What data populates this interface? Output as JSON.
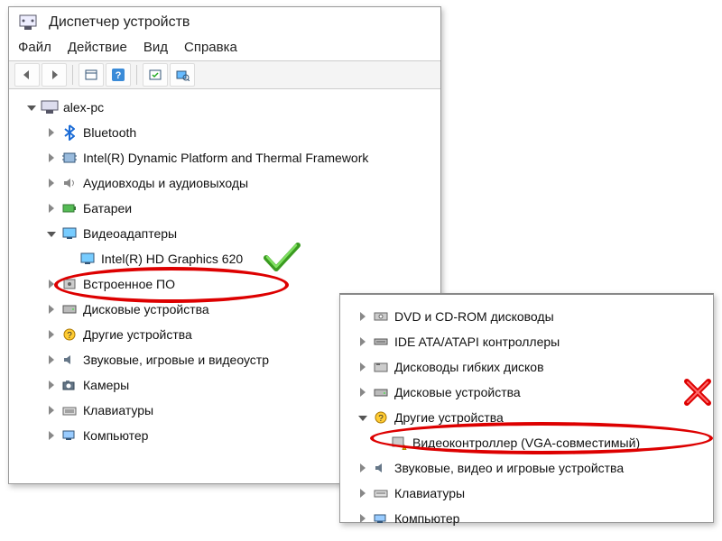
{
  "window": {
    "title": "Диспетчер устройств",
    "menus": [
      "Файл",
      "Действие",
      "Вид",
      "Справка"
    ]
  },
  "toolbar_icons": [
    "arrow-left-icon",
    "arrow-right-icon",
    "properties-icon",
    "help-icon",
    "refresh-icon",
    "search-icon"
  ],
  "tree_main": {
    "root": "alex-pc",
    "items": [
      {
        "label": "Bluetooth",
        "icon": "bluetooth"
      },
      {
        "label": "Intel(R) Dynamic Platform and Thermal Framework",
        "icon": "chip"
      },
      {
        "label": "Аудиовходы и аудиовыходы",
        "icon": "audio"
      },
      {
        "label": "Батареи",
        "icon": "battery"
      },
      {
        "label": "Видеоадаптеры",
        "icon": "display",
        "expanded": true
      },
      {
        "label": "Intel(R) HD Graphics 620",
        "icon": "display",
        "child": true
      },
      {
        "label": "Встроенное ПО",
        "icon": "firmware"
      },
      {
        "label": "Дисковые устройства",
        "icon": "disk"
      },
      {
        "label": "Другие устройства",
        "icon": "unknown"
      },
      {
        "label": "Звуковые, игровые и видеоустр",
        "icon": "sound"
      },
      {
        "label": "Камеры",
        "icon": "camera"
      },
      {
        "label": "Клавиатуры",
        "icon": "keyboard"
      },
      {
        "label": "Компьютер",
        "icon": "computer"
      }
    ]
  },
  "tree_second": {
    "items": [
      {
        "label": "DVD и CD-ROM дисководы",
        "icon": "optical"
      },
      {
        "label": "IDE ATA/ATAPI контроллеры",
        "icon": "ide"
      },
      {
        "label": "Дисководы гибких дисков",
        "icon": "floppy"
      },
      {
        "label": "Дисковые устройства",
        "icon": "disk"
      },
      {
        "label": "Другие устройства",
        "icon": "unknown",
        "expanded": true
      },
      {
        "label": "Видеоконтроллер (VGA-совместимый)",
        "icon": "warn",
        "child": true
      },
      {
        "label": "Звуковые, видео и игровые устройства",
        "icon": "sound"
      },
      {
        "label": "Клавиатуры",
        "icon": "keyboard"
      },
      {
        "label": "Компьютер",
        "icon": "computer"
      }
    ]
  },
  "annotations": {
    "good_device": "Intel(R) HD Graphics 620",
    "bad_device": "Видеоконтроллер (VGA-совместимый)"
  }
}
